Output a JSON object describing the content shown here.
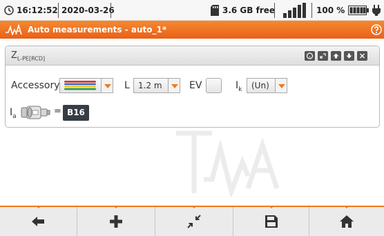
{
  "status_bar": {
    "time": "16:12:52",
    "date": "2020-03-26",
    "storage": "3.6 GB free",
    "battery": "100 %",
    "signal_icon": "signal-bars-icon",
    "battery_icon": "battery-icon",
    "power_icon": "plug-icon",
    "sd_icon": "sd-card-icon"
  },
  "title_bar": {
    "title": "Auto measurements - auto_1*",
    "help_icon": "help-icon"
  },
  "panel": {
    "title_main": "Z",
    "title_sub": "L-PE[RCD]",
    "header_buttons": [
      "help-icon",
      "expand-icon",
      "up-icon",
      "down-icon",
      "close-icon"
    ],
    "accessory_label": "Accessory",
    "accessory_colors": [
      "#d9302b",
      "#3b6cc6",
      "#f2cc1c",
      "#2a9a43"
    ],
    "length_label": "L",
    "length_value": "1.2 m",
    "ev_label": "EV",
    "ev_checked": false,
    "ik_label": "I",
    "ik_sub": "k",
    "ik_value": "(Un)",
    "ia_label": "I",
    "ia_sub": "a",
    "equals": "=",
    "fuse_value": "B16"
  },
  "toolbar": {
    "buttons": [
      "back-icon",
      "add-icon",
      "collapse-icon",
      "save-icon",
      "home-icon"
    ]
  },
  "colors": {
    "accent": "#f07a1c",
    "title_bar": "#ee6b23",
    "fuse_badge": "#363d44"
  }
}
